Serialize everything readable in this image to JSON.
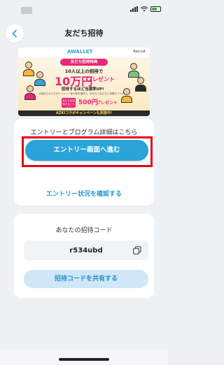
{
  "nav": {
    "title": "友だち招待"
  },
  "banner": {
    "brand_left": "AWALLET",
    "brand_right": "Recruit",
    "badge": "友だち招待特典",
    "line1": "10人以上の招待で",
    "amount": "10万円",
    "present": "プレゼント",
    "line3": "招待するほど当選率UP!",
    "small_note": "※招待された方がエントリー後の条件達成で、あなたと友だちに特典をプレゼント",
    "badge500": "友だちを招待するごとに",
    "amount500": "500円",
    "present500": "プレゼント",
    "footer": "AZKIコラボキャンペーンも実施中!"
  },
  "entry": {
    "title": "エントリーとプログラム詳細はこちら",
    "button_label": "エントリー画面へ進む",
    "status_link": "エントリー状況を確認する"
  },
  "invite": {
    "title": "あなたの招待コード",
    "code": "r534ubd",
    "share_button": "招待コードを共有する"
  },
  "colors": {
    "primary": "#2aa4d8",
    "highlight": "#e60012",
    "banner_pink": "#e6277a"
  }
}
